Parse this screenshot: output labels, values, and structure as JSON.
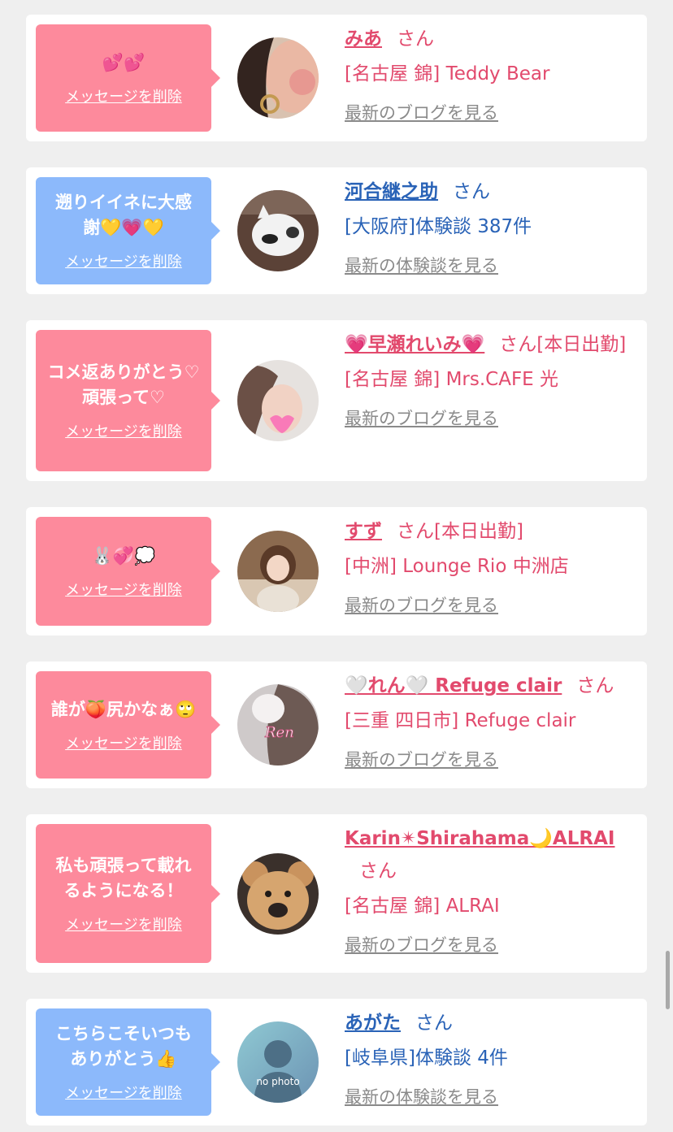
{
  "cards": [
    {
      "message": "💕💕",
      "delete_label": "メッセージを削除",
      "name": "みあ",
      "honorific": "さん",
      "shop": "[名古屋 錦] Teddy Bear",
      "latest_link": "最新のブログを見る"
    },
    {
      "message": "遡りイイネに大感謝💛💗💛",
      "delete_label": "メッセージを削除",
      "name": "河合継之助",
      "honorific": "さん",
      "shop": "[大阪府]体験談 387件",
      "latest_link": "最新の体験談を見る"
    },
    {
      "message": "コメ返ありがとう♡頑張って♡",
      "delete_label": "メッセージを削除",
      "name": "💗早瀬れいみ💗",
      "honorific": "さん[本日出勤]",
      "shop": "[名古屋 錦] Mrs.CAFE 光",
      "latest_link": "最新のブログを見る"
    },
    {
      "message": "🐰💞💭",
      "delete_label": "メッセージを削除",
      "name": "すず",
      "honorific": "さん[本日出勤]",
      "shop": "[中洲] Lounge Rio 中洲店",
      "latest_link": "最新のブログを見る"
    },
    {
      "message": "誰が🍑尻かなぁ🙄",
      "delete_label": "メッセージを削除",
      "name": "🤍れん🤍 Refuge clair",
      "honorific": "さん",
      "shop": "[三重 四日市] Refuge clair",
      "latest_link": "最新のブログを見る",
      "avatar_text": "Ren"
    },
    {
      "message": "私も頑張って載れるようになる！",
      "delete_label": "メッセージを削除",
      "name": "Karin✴Shirahama🌙ALRAI",
      "honorific": "さん",
      "shop": "[名古屋 錦] ALRAI",
      "latest_link": "最新のブログを見る"
    },
    {
      "message": "こちらこそいつもありがとう👍",
      "delete_label": "メッセージを削除",
      "name": "あがた",
      "honorific": "さん",
      "shop": "[岐阜県]体験談 4件",
      "latest_link": "最新の体験談を見る",
      "avatar_text": "no photo"
    }
  ],
  "colors": {
    "pink_bubble": "#fd8a9c",
    "blue_bubble": "#8cb9fb",
    "name_pink": "#e24a6d",
    "name_blue": "#2a63b7",
    "link_gray": "#8a8a8a"
  }
}
